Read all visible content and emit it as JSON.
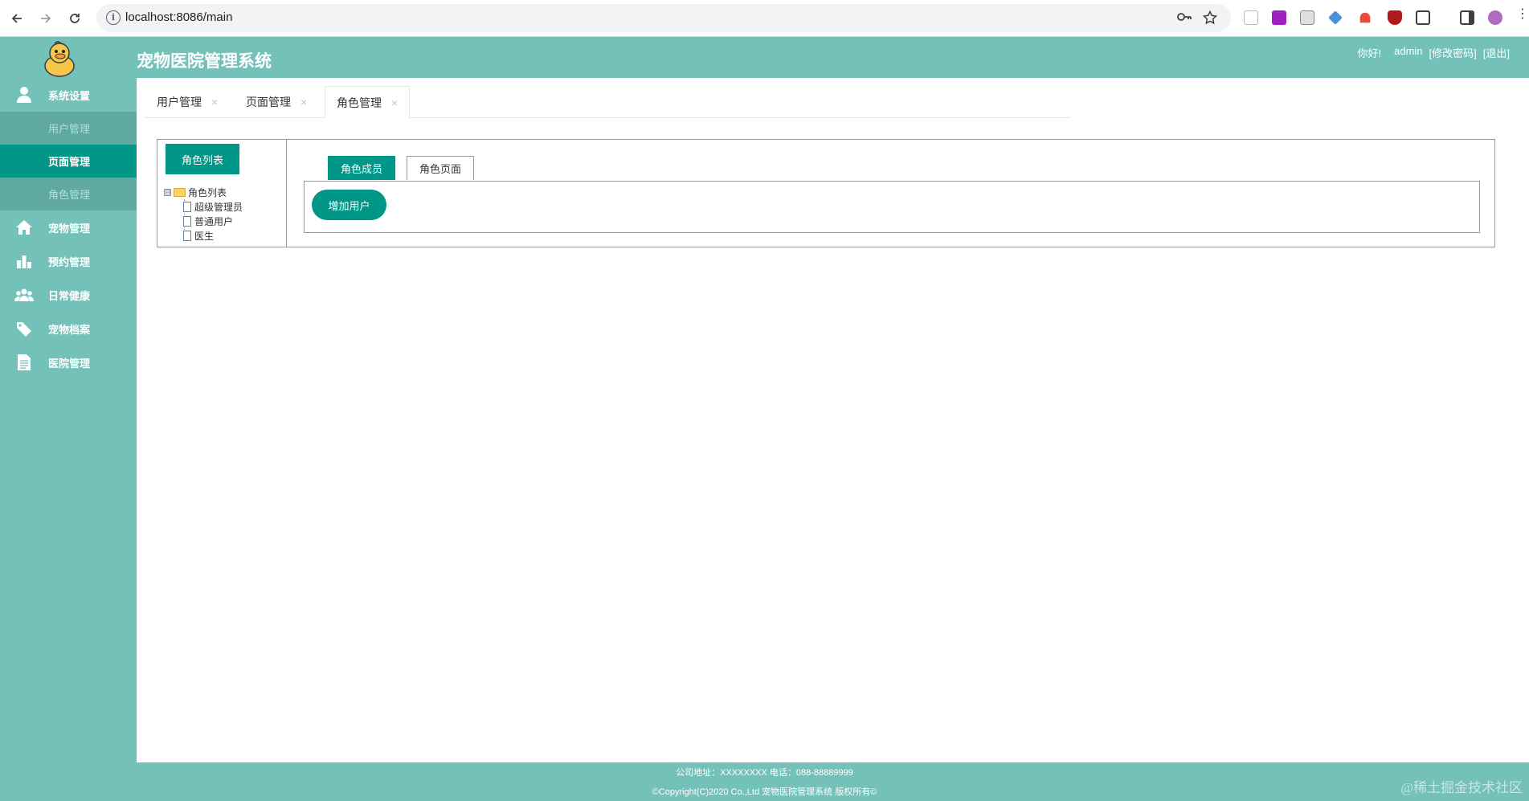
{
  "browser": {
    "url": "localhost:8086/main",
    "back_icon": "arrow-left-icon",
    "forward_icon": "arrow-right-icon",
    "reload_icon": "reload-icon"
  },
  "header": {
    "title": "宠物医院管理系统",
    "greeting": "你好!",
    "username": "admin",
    "change_password": "[修改密码]",
    "logout": "[退出]"
  },
  "sidebar": {
    "items": [
      {
        "label": "系统设置",
        "icon": "user-icon"
      },
      {
        "label": "宠物管理",
        "icon": "home-icon"
      },
      {
        "label": "预约管理",
        "icon": "bar-chart-icon"
      },
      {
        "label": "日常健康",
        "icon": "group-icon"
      },
      {
        "label": "宠物档案",
        "icon": "tag-icon"
      },
      {
        "label": "医院管理",
        "icon": "document-icon"
      }
    ],
    "sub_items": [
      {
        "label": "用户管理"
      },
      {
        "label": "页面管理"
      },
      {
        "label": "角色管理"
      }
    ]
  },
  "tabs": [
    {
      "label": "用户管理",
      "close": "×"
    },
    {
      "label": "页面管理",
      "close": "×"
    },
    {
      "label": "角色管理",
      "close": "×"
    }
  ],
  "role_panel": {
    "list_button": "角色列表",
    "tree_root": "角色列表",
    "tree_toggle": "⊟",
    "roles": [
      "超级管理员",
      "普通用户",
      "医生"
    ],
    "subtabs": [
      "角色成员",
      "角色页面"
    ],
    "add_user_button": "增加用户"
  },
  "footer": {
    "line1": "公司地址：XXXXXXXX 电话：088-88889999",
    "line2": "©Copyright(C)2020 Co.,Ltd 宠物医院管理系统 版权所有©"
  },
  "watermark": "@稀土掘金技术社区",
  "colors": {
    "theme": "#74c1b9",
    "primary": "#009688",
    "sub_muted": "#5fa9a2"
  }
}
